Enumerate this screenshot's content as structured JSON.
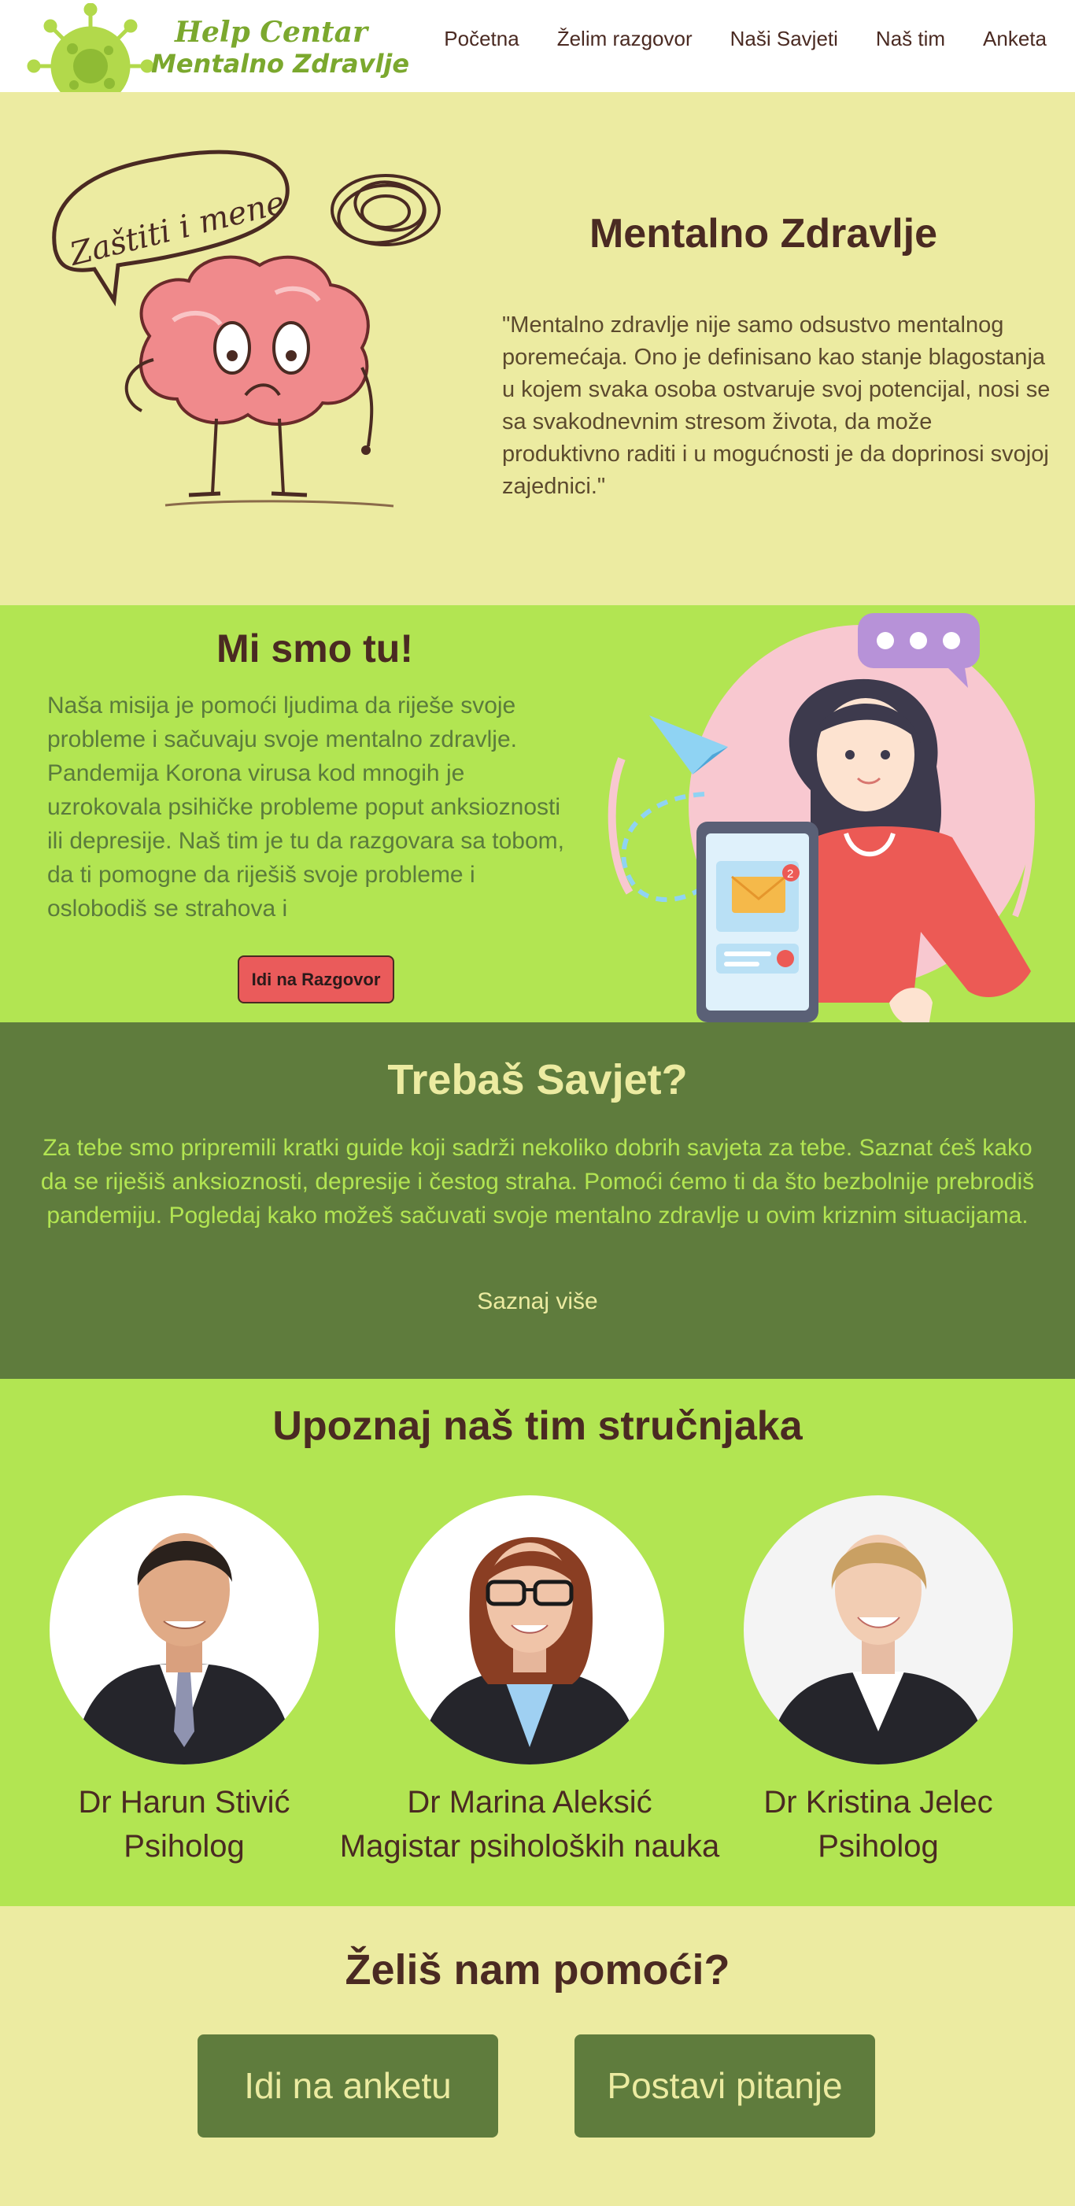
{
  "nav": {
    "brand_line1": "Help Centar",
    "brand_line2": "Mentalno Zdravlje",
    "links": [
      "Početna",
      "Želim razgovor",
      "Naši Savjeti",
      "Naš tim",
      "Anketa"
    ]
  },
  "hero": {
    "speech_bubble": "Zaštiti i mene",
    "title": "Mentalno Zdravlje",
    "text": "\"Mentalno zdravlje nije samo odsustvo mentalnog poremećaja. Ono je definisano kao stanje blagostanja u kojem svaka osoba ostvaruje svoj potencijal, nosi se sa svakodnevnim stresom života, da može produktivno raditi i u mogućnosti je da doprinosi svojoj zajednici.\""
  },
  "mission": {
    "title": "Mi smo tu!",
    "text": "Naša misija je pomoći ljudima da riješe svoje probleme i sačuvaju svoje mentalno zdravlje. Pandemija Korona virusa kod mnogih je uzrokovala psihičke probleme poput anksioznosti ili depresije. Naš tim je tu da razgovara sa tobom, da ti pomogne da riješiš svoje probleme i oslobodiš se strahova i",
    "button": "Idi na Razgovor",
    "notification_count": "2"
  },
  "advice": {
    "title": "Trebaš Savjet?",
    "text": "Za tebe smo pripremili kratki guide koji sadrži nekoliko dobrih savjeta za tebe. Saznat ćeš kako da se riješiš anksioznosti, depresije i čestog straha. Pomoći ćemo ti da što bezbolnije prebrodiš pandemiju. Pogledaj kako možeš sačuvati svoje mentalno zdravlje u ovim kriznim situacijama.",
    "link": "Saznaj više"
  },
  "team": {
    "title": "Upoznaj naš tim stručnjaka",
    "members": [
      {
        "name": "Dr Harun Stivić",
        "role": "Psiholog"
      },
      {
        "name": "Dr Marina Aleksić",
        "role": "Magistar psiholoških nauka"
      },
      {
        "name": "Dr Kristina Jelec",
        "role": "Psiholog"
      }
    ]
  },
  "help": {
    "title": "Želiš nam pomoći?",
    "button_survey": "Idi na anketu",
    "button_question": "Postavi pitanje"
  },
  "colors": {
    "cream": "#eceba1",
    "lime": "#b2e552",
    "olive": "#5f7c3d",
    "brown_text": "#4a2a22",
    "brand_green": "#7ba82e",
    "button_red": "#ea5b5b"
  }
}
